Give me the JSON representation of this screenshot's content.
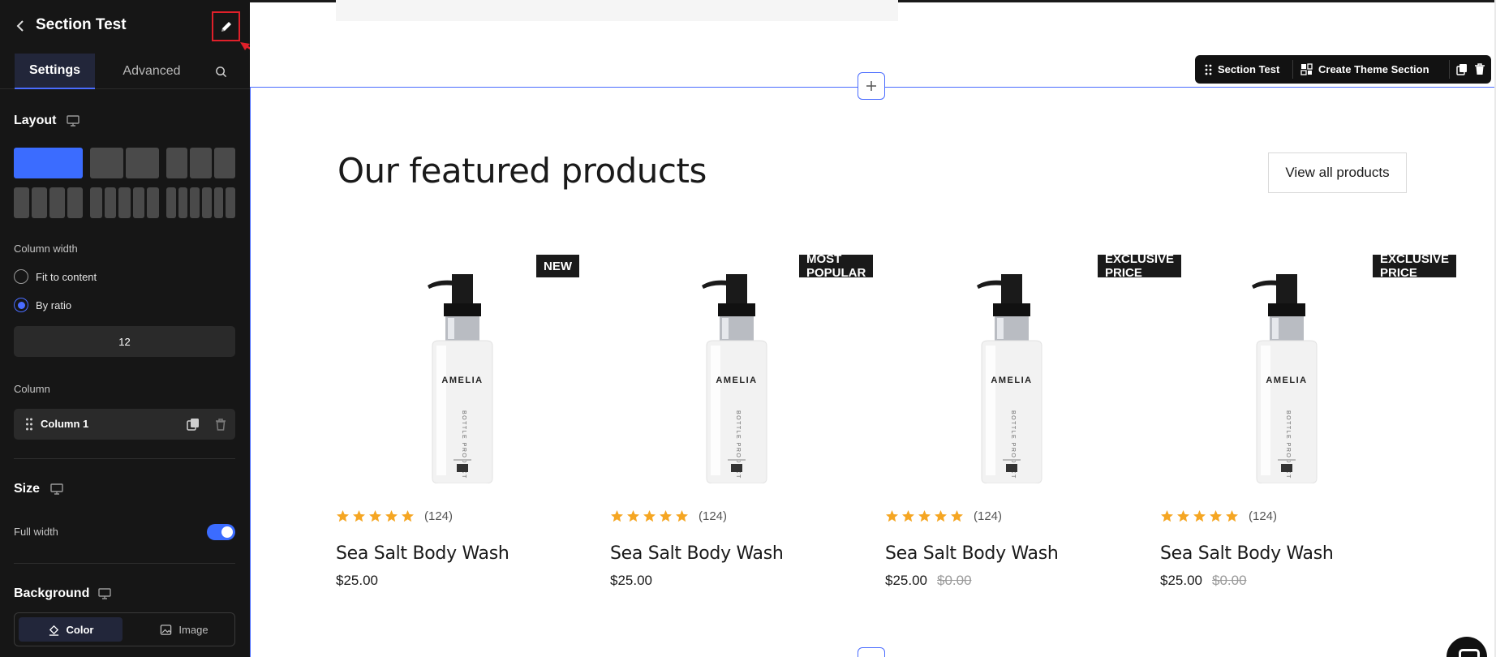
{
  "sidebar": {
    "title": "Section Test",
    "tabs": [
      {
        "label": "Settings"
      },
      {
        "label": "Advanced"
      }
    ],
    "layout": {
      "label": "Layout"
    },
    "column_width": {
      "label": "Column width",
      "options": [
        "Fit to content",
        "By ratio"
      ],
      "ratio_value": "12"
    },
    "column": {
      "label": "Column",
      "items": [
        {
          "label": "Column 1"
        }
      ]
    },
    "size": {
      "label": "Size",
      "full_width_label": "Full width"
    },
    "background": {
      "label": "Background",
      "options": [
        "Color",
        "Image"
      ]
    }
  },
  "toolbar": {
    "section_label": "Section Test",
    "create_label": "Create Theme Section"
  },
  "section": {
    "heading": "Our featured products",
    "view_all": "View all products",
    "products": [
      {
        "badge": "NEW",
        "rating_count": "(124)",
        "name": "Sea Salt Body Wash",
        "price": "$25.00",
        "compare_price": "",
        "brand": "AMELIA"
      },
      {
        "badge": "MOST POPULAR",
        "rating_count": "(124)",
        "name": "Sea Salt Body Wash",
        "price": "$25.00",
        "compare_price": "",
        "brand": "AMELIA"
      },
      {
        "badge": "EXCLUSIVE PRICE",
        "rating_count": "(124)",
        "name": "Sea Salt Body Wash",
        "price": "$25.00",
        "compare_price": "$0.00",
        "brand": "AMELIA"
      },
      {
        "badge": "EXCLUSIVE PRICE",
        "rating_count": "(124)",
        "name": "Sea Salt Body Wash",
        "price": "$25.00",
        "compare_price": "$0.00",
        "brand": "AMELIA"
      }
    ]
  },
  "colors": {
    "sidebar_bg": "#161616",
    "accent": "#3b6cff",
    "star": "#f5a623",
    "highlight_box": "#e0202a"
  }
}
